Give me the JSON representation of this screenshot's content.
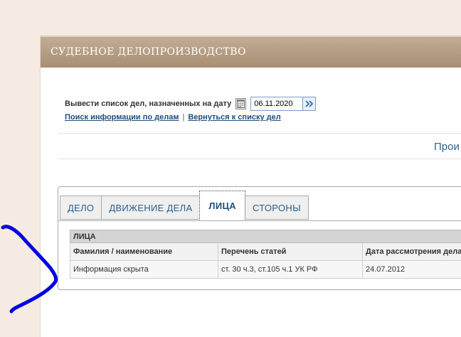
{
  "header": {
    "title": "СУДЕБНОЕ ДЕЛОПРОИЗВОДСТВО"
  },
  "date_form": {
    "label": "Вывести список дел, назначенных на дату",
    "date_value": "06.11.2020"
  },
  "links": {
    "search": "Поиск информации по делам",
    "separator": "|",
    "back": "Вернуться к списку дел"
  },
  "truncated_heading": "Прои",
  "tabs": [
    {
      "label": "ДЕЛО",
      "active": false
    },
    {
      "label": "ДВИЖЕНИЕ ДЕЛА",
      "active": false
    },
    {
      "label": "ЛИЦА",
      "active": true
    },
    {
      "label": "СТОРОНЫ",
      "active": false
    }
  ],
  "persons_table": {
    "caption": "ЛИЦА",
    "columns": [
      "Фамилия / наименование",
      "Перечень статей",
      "Дата рассмотрения дела"
    ],
    "rows": [
      [
        "Информация скрыта",
        "ст. 30 ч.3, ст.105 ч.1 УК РФ",
        "24.07.2012"
      ]
    ]
  },
  "annotation": {
    "color": "#0000e0",
    "shape": "hand-drawn bracket"
  }
}
